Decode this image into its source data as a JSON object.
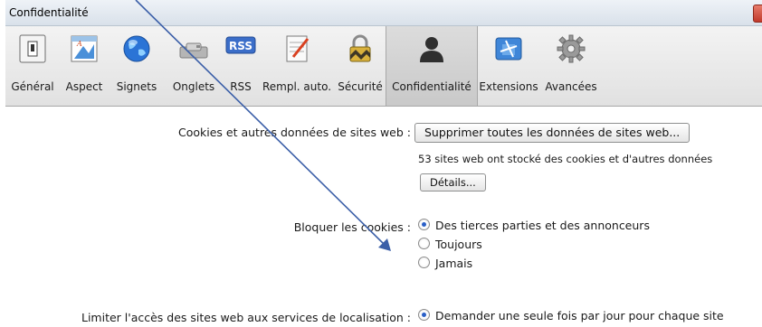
{
  "window": {
    "title": "Confidentialité"
  },
  "toolbar": {
    "items": [
      {
        "label": "Général",
        "icon": "general-switch-icon"
      },
      {
        "label": "Aspect",
        "icon": "appearance-icon"
      },
      {
        "label": "Signets",
        "icon": "globe-icon"
      },
      {
        "label": "Onglets",
        "icon": "tabs-icon"
      },
      {
        "label": "RSS",
        "icon": "rss-icon"
      },
      {
        "label": "Rempl. auto.",
        "icon": "autofill-pen-icon"
      },
      {
        "label": "Sécurité",
        "icon": "padlock-icon"
      },
      {
        "label": "Confidentialité",
        "icon": "person-silhouette-icon",
        "selected": true
      },
      {
        "label": "Extensions",
        "icon": "puzzle-icon"
      },
      {
        "label": "Avancées",
        "icon": "gear-icon"
      }
    ],
    "rss_badge": "RSS"
  },
  "cookies": {
    "label": "Cookies et autres données de sites web :",
    "remove_all_button": "Supprimer toutes les données de sites web...",
    "note": "53 sites web ont stocké des cookies et d'autres données",
    "details_button": "Détails..."
  },
  "block": {
    "label": "Bloquer les cookies :",
    "options": [
      {
        "label": "Des tierces parties et des annonceurs",
        "checked": true
      },
      {
        "label": "Toujours",
        "checked": false
      },
      {
        "label": "Jamais",
        "checked": false
      }
    ]
  },
  "location": {
    "label": "Limiter l'accès des sites web aux services de localisation :",
    "option": "Demander une seule fois par jour pour chaque site"
  },
  "colors": {
    "annotation_arrow": "#3b5fa8",
    "close_button": "#c0392b",
    "radio_selected": "#2a5fc7"
  }
}
